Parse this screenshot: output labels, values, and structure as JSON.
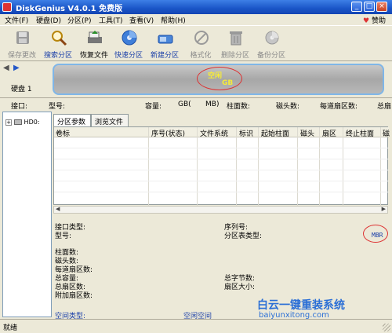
{
  "window": {
    "title": "DiskGenius V4.0.1 免费版",
    "min": "_",
    "max": "□",
    "close": "×"
  },
  "menu": {
    "items": [
      "文件(F)",
      "硬盘(D)",
      "分区(P)",
      "工具(T)",
      "查看(V)",
      "帮助(H)"
    ],
    "help_link": "赞助"
  },
  "toolbar": {
    "save": "保存更改",
    "search": "搜索分区",
    "recover": "恢复文件",
    "quick": "快速分区",
    "new": "新建分区",
    "format": "格式化",
    "delete": "删除分区",
    "backup": "备份分区"
  },
  "diskbar": {
    "nav_back": "◀",
    "nav_fwd": "▶",
    "disk_label": "硬盘 1",
    "free_label": "空闲",
    "free_size": "GB"
  },
  "infoline": {
    "iface": "接口:",
    "model": "型号:",
    "capacity": "容量:",
    "cap_unit": "GB(",
    "cap_mb": "MB)",
    "cyl": "柱面数:",
    "heads": "磁头数:",
    "spt": "每道扇区数:",
    "total": "总扇"
  },
  "tree": {
    "node": "HD0:"
  },
  "tabs": {
    "partition_params": "分区参数",
    "browse_files": "浏览文件"
  },
  "grid": {
    "headers": [
      "卷标",
      "序号(状态)",
      "文件系统",
      "标识",
      "起始柱面",
      "磁头",
      "扇区",
      "终止柱面",
      "磁"
    ]
  },
  "details": {
    "iface_type": "接口类型:",
    "serial": "序列号:",
    "model": "型号:",
    "pt_type": "分区表类型:",
    "pt_value": "MBR",
    "cylinders": "柱面数:",
    "heads": "磁头数:",
    "spt": "每道扇区数:",
    "total_cap": "总容量:",
    "total_bytes": "总字节数:",
    "total_sectors": "总扇区数:",
    "sector_size": "扇区大小:",
    "extra_sectors": "附加扇区数:",
    "space_type": "空间类型:",
    "free_space": "空闲空间"
  },
  "watermark": {
    "cn": "白云一键重装系统",
    "url": "baiyunxitong.com"
  },
  "status": {
    "text": "就绪"
  }
}
